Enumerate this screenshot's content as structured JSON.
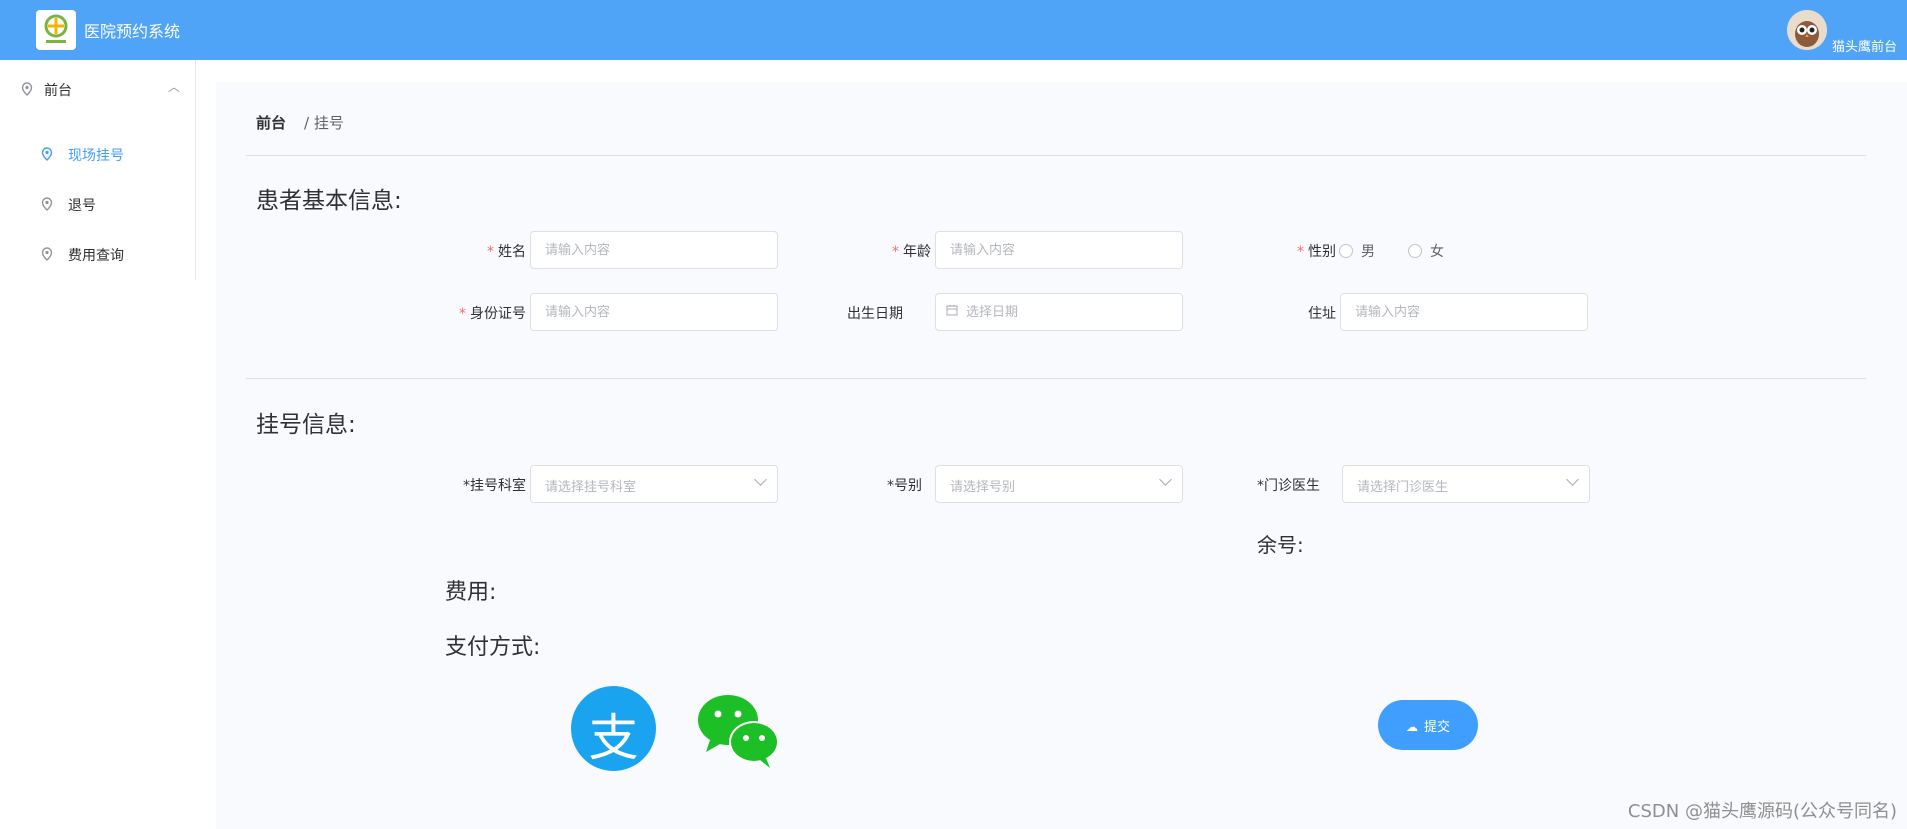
{
  "header": {
    "app_title": "医院预约系统",
    "user_name": "猫头鹰前台"
  },
  "sidebar": {
    "group_label": "前台",
    "items": [
      {
        "label": "现场挂号",
        "active": true
      },
      {
        "label": "退号",
        "active": false
      },
      {
        "label": "费用查询",
        "active": false
      }
    ]
  },
  "breadcrumb": {
    "first": "前台",
    "second": "/ 挂号"
  },
  "patient": {
    "title": "患者基本信息:",
    "required_mark": "*",
    "name_label": "姓名",
    "name_placeholder": "请输入内容",
    "age_label": "年龄",
    "age_placeholder": "请输入内容",
    "gender_label": "性别",
    "gender_male": "男",
    "gender_female": "女",
    "id_label": "身份证号",
    "id_placeholder": "请输入内容",
    "birth_label": "出生日期",
    "birth_placeholder": "选择日期",
    "address_label": "住址",
    "address_placeholder": "请输入内容"
  },
  "registration": {
    "title": "挂号信息:",
    "dept_label": "*挂号科室",
    "dept_placeholder": "请选择挂号科室",
    "type_label": "*号别",
    "type_placeholder": "请选择号别",
    "doctor_label": "*门诊医生",
    "doctor_placeholder": "请选择门诊医生",
    "remaining_label": "余号:",
    "fee_label": "费用:",
    "payment_label": "支付方式:",
    "submit_label": "提交"
  },
  "icons": {
    "alipay_glyph": "支"
  },
  "colors": {
    "header": "#4fa4f7",
    "primary": "#409eff",
    "alipay": "#1aa4f0",
    "wechat": "#1dbf26"
  },
  "watermark": "CSDN @猫头鹰源码(公众号同名)"
}
